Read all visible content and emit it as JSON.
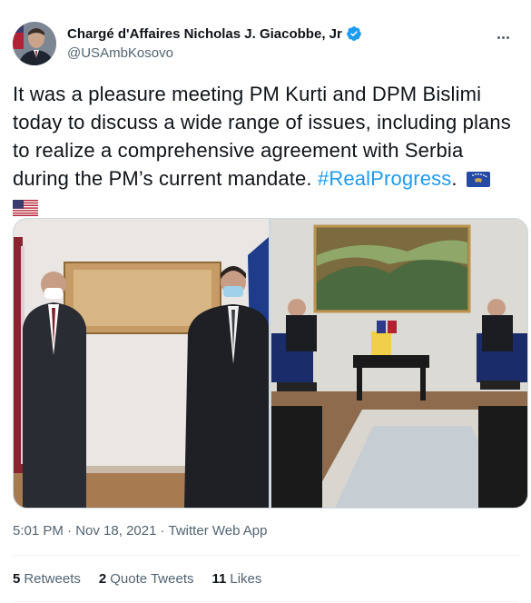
{
  "author": {
    "display_name": "Chargé d'Affaires Nicholas J. Giacobbe, Jr",
    "handle": "@USAmbKosovo",
    "verified_icon": "verified-badge-icon"
  },
  "tweet": {
    "text_before_hashtag": "It was a pleasure meeting PM Kurti and DPM Bislimi today to discuss a wide range of issues, including plans to realize a comprehensive agreement with Serbia during the PM’s current mandate. ",
    "hashtag": "#RealProgress",
    "text_after_hashtag": ".",
    "emoji_flags": [
      "kosovo-flag-icon",
      "us-flag-icon"
    ]
  },
  "media": {
    "left_photo": "Two men standing wearing face masks in front of flags",
    "right_photo": "Meeting in a room with sofas and a landscape painting"
  },
  "meta": {
    "time": "5:01 PM",
    "separator": " · ",
    "date": "Nov 18, 2021",
    "source": "Twitter Web App"
  },
  "stats": {
    "retweets_count": "5",
    "retweets_label": "Retweets",
    "quotes_count": "2",
    "quotes_label": "Quote Tweets",
    "likes_count": "11",
    "likes_label": "Likes"
  },
  "colors": {
    "link": "#1d9bf0",
    "text": "#0f1419",
    "secondary": "#536471"
  }
}
